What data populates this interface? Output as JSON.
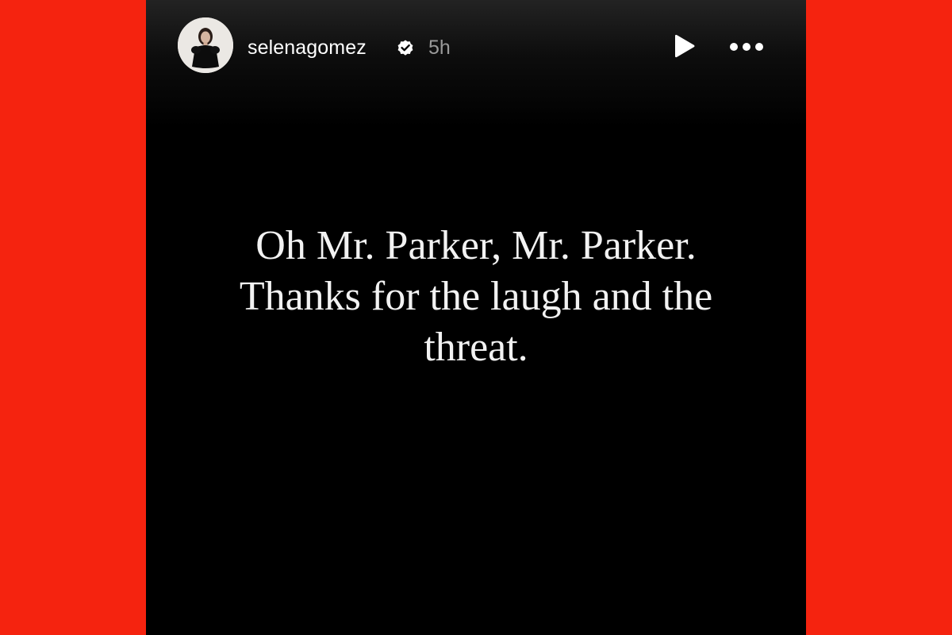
{
  "story": {
    "username": "selenagomez",
    "time": "5h",
    "verified_icon": "verified-badge-icon",
    "avatar_icon": "profile-avatar",
    "controls": {
      "play_icon": "play-icon",
      "more_icon": "more-options-icon"
    },
    "caption": {
      "line1": "Oh Mr. Parker, Mr. Parker.",
      "line2": "Thanks for the laugh and the",
      "line3": "threat."
    }
  },
  "colors": {
    "background": "#f5230f",
    "story_bg": "#000000",
    "text": "#ffffff",
    "muted": "#9a9a9a"
  }
}
